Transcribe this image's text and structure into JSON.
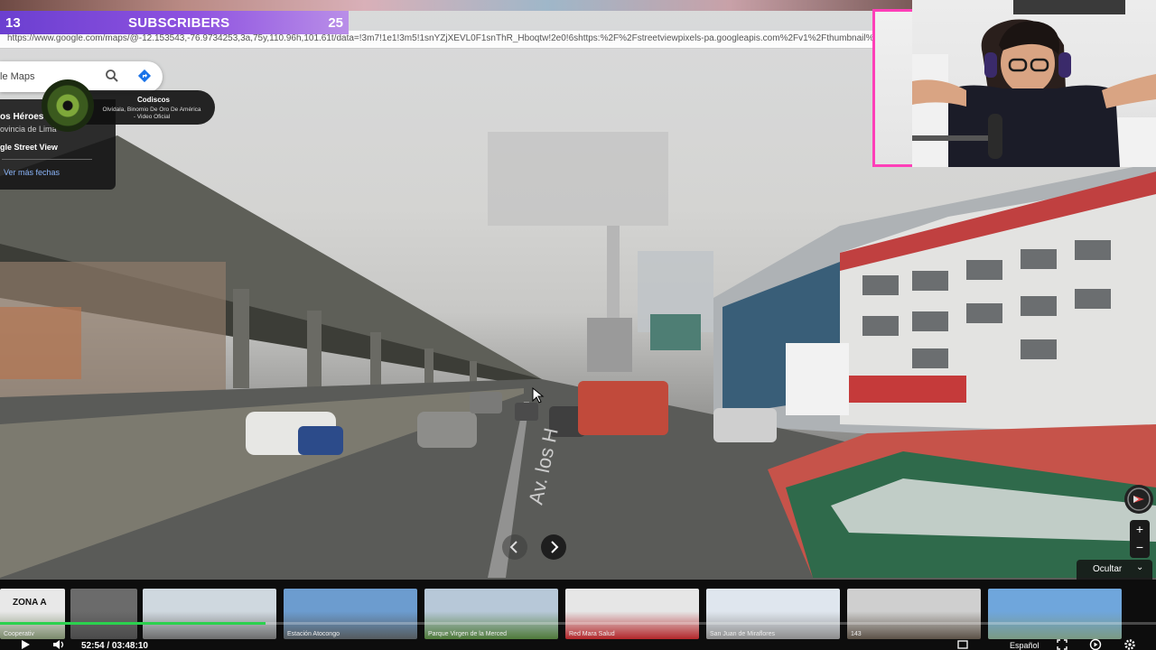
{
  "stream": {
    "subscribers_current": "13",
    "subscribers_label": "SUBSCRIBERS",
    "subscribers_goal": "25",
    "progress_fraction": 0.23
  },
  "browser": {
    "url": "https://www.google.com/maps/@-12.153543,-76.9734253,3a,75y,110.96h,101.61t/data=!3m7!1e1!3m5!1snYZjXEVL0F1snThR_Hboqtw!2e0!6shttps:%2F%2Fstreetviewpixels-pa.googleapis.com%2Fv1%2Fthumbnail%3F...client%"
  },
  "maps": {
    "search_text": "le Maps",
    "place_name": "os Héroes",
    "place_region": "ovincia de Lima",
    "street_view_label": "gle Street View",
    "more_dates_link": "Ver más fechas",
    "road_label": "Av. los H",
    "hide_label": "Ocultar",
    "zoom_in": "+",
    "zoom_out": "−"
  },
  "music": {
    "title": "Codiscos",
    "subtitle": "Olvídala, Binomio De Oro De América - Video Oficial"
  },
  "thumbnails": [
    {
      "caption": "Cooperativ",
      "overlay": "ZONA A",
      "colors": [
        "#e8e8e8",
        "#7b8a6c"
      ]
    },
    {
      "caption": "",
      "overlay": "",
      "colors": [
        "#6b6b6b",
        "#4a4a4a"
      ]
    },
    {
      "caption": "",
      "overlay": "",
      "colors": [
        "#cfd8df",
        "#6d6d6d"
      ]
    },
    {
      "caption": "Estación Atocongo",
      "overlay": "",
      "colors": [
        "#6c9ccf",
        "#555b5e"
      ]
    },
    {
      "caption": "Parque Virgen de la Merced",
      "overlay": "",
      "colors": [
        "#b7c8d8",
        "#4f7a3a"
      ]
    },
    {
      "caption": "Red Mara Salud",
      "overlay": "",
      "colors": [
        "#e6e6e6",
        "#b3262a"
      ]
    },
    {
      "caption": "San Juan de Miraflores",
      "overlay": "",
      "colors": [
        "#dfe6ee",
        "#8d8d8d"
      ]
    },
    {
      "caption": "143",
      "overlay": "",
      "colors": [
        "#cfcfcf",
        "#5c5247"
      ]
    },
    {
      "caption": "",
      "overlay": "",
      "colors": [
        "#6fa6dc",
        "#7b9a83"
      ]
    }
  ],
  "player": {
    "time": "52:54 / 03:48:10",
    "played_fraction": 0.23,
    "language": "Español"
  },
  "colors": {
    "subs_bar": "#8e52e0",
    "cam_border": "#ff3fb8",
    "progress": "#2bd14e"
  },
  "icons": [
    "search-icon",
    "directions-icon",
    "chevron-left-icon",
    "chevron-right-icon",
    "compass-icon",
    "play-icon",
    "volume-icon",
    "fullscreen-icon",
    "settings-icon"
  ]
}
